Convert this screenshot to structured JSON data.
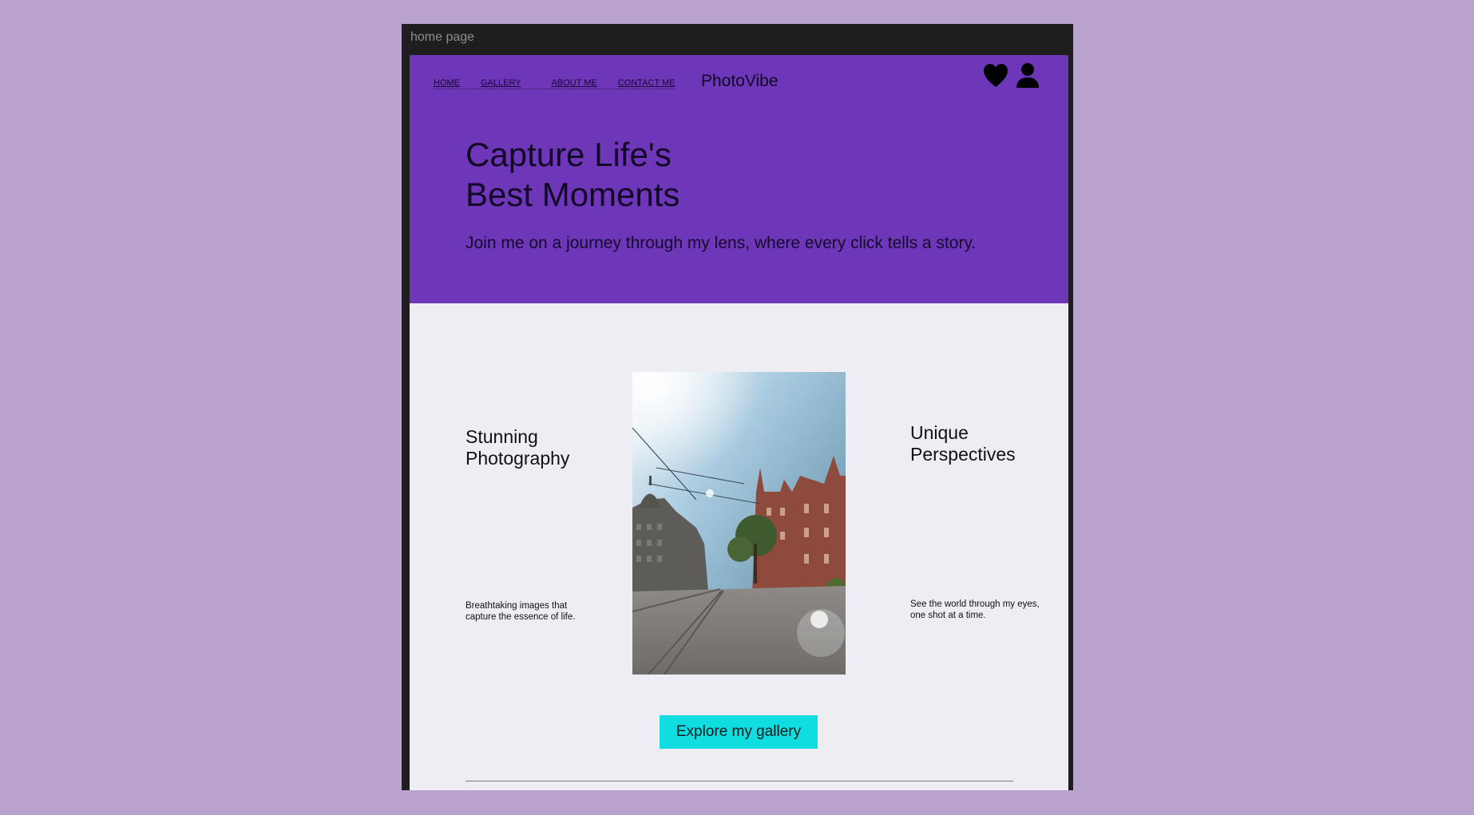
{
  "window": {
    "title": "home page"
  },
  "nav": {
    "items": [
      {
        "label": "HOME"
      },
      {
        "label": "GALLERY"
      },
      {
        "label": "ABOUT ME"
      },
      {
        "label": "CONTACT ME"
      }
    ]
  },
  "brand": "PhotoVibe",
  "header_icons": [
    "heart-icon",
    "user-icon"
  ],
  "hero": {
    "title": "Capture Life's\nBest Moments",
    "subtitle": "Join me on a journey through my lens, where every click tells a story."
  },
  "features": {
    "left": {
      "title": "Stunning\nPhotography",
      "description": "Breathtaking images that\ncapture the essence of life."
    },
    "right": {
      "title": "Unique\nPerspectives",
      "description": "See the world through my eyes,\none shot at a time."
    }
  },
  "cta": {
    "label": "Explore my gallery"
  },
  "colors": {
    "background": "#b9a2cd",
    "frame": "#1e1e1e",
    "hero": "#6e37b9",
    "page": "#efedf4",
    "cta": "#10dde0"
  }
}
